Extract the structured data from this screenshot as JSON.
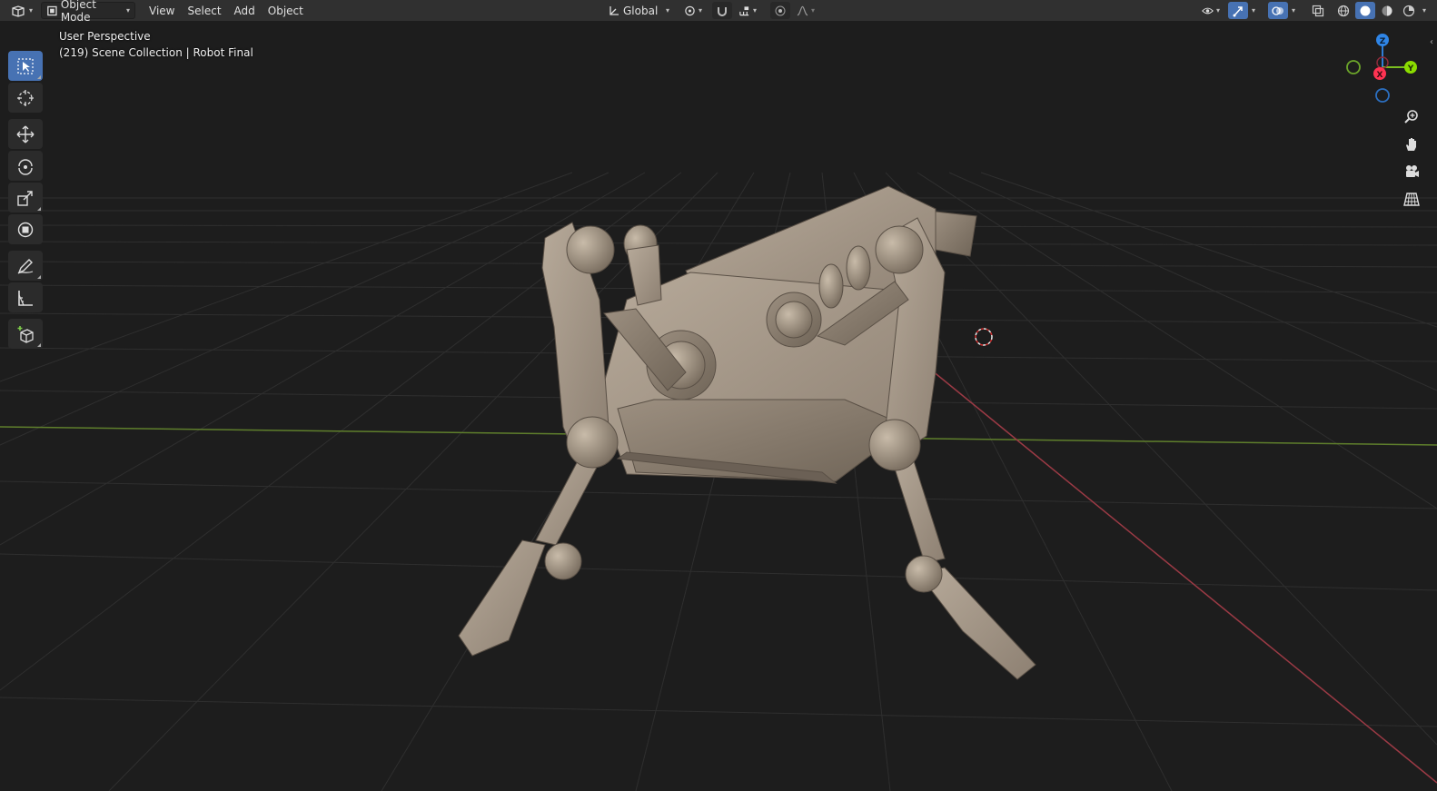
{
  "header": {
    "editor_type_icon": "3d-viewport-icon",
    "mode_label": "Object Mode",
    "menus": [
      "View",
      "Select",
      "Add",
      "Object"
    ],
    "transform_orientation": "Global"
  },
  "viewport": {
    "view_name": "User Perspective",
    "scene_info": "(219) Scene Collection | Robot Final"
  },
  "gizmo": {
    "axis_z": "Z",
    "axis_y": "Y",
    "axis_x": "X",
    "colors": {
      "x": "#ff3352",
      "y": "#8bdc00",
      "z": "#2890ff"
    }
  },
  "toolbar": [
    "select-box",
    "cursor",
    "move",
    "rotate",
    "scale",
    "transform",
    "annotate",
    "measure",
    "add-cube"
  ],
  "colors": {
    "header_bg": "#303030",
    "viewport_bg": "#1d1d1d",
    "active_blue": "#4772b3",
    "grid_x": "#9b3a45",
    "grid_y": "#6a8a2f"
  }
}
